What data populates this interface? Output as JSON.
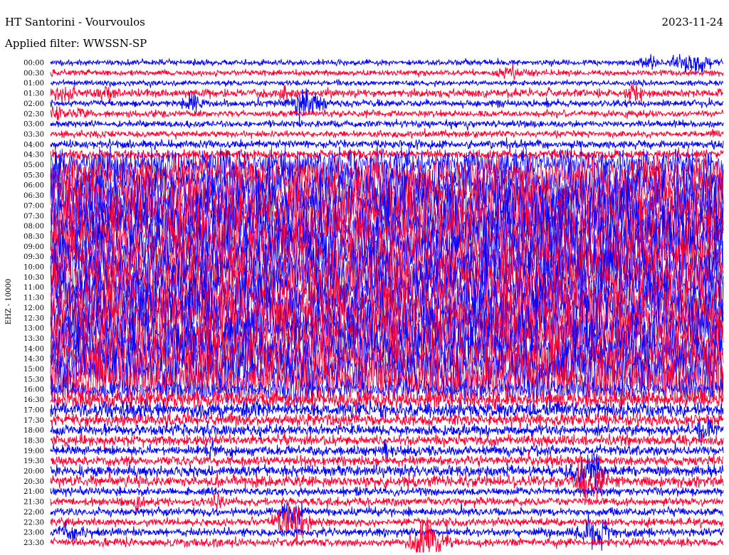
{
  "header": {
    "station": "HT Santorini - Vourvoulos",
    "date": "2023-11-24",
    "filter": "Applied filter: WWSSN-SP"
  },
  "colors": {
    "even_trace": "#0000ff",
    "odd_trace": "#ff0033",
    "background": "#ffffff",
    "text": "#000000"
  },
  "chart_data": {
    "type": "helicorder",
    "ylabel": "EHZ - 10000",
    "tick_labels": [
      "00:00",
      "00:30",
      "01:00",
      "01:30",
      "02:00",
      "02:30",
      "03:00",
      "03:30",
      "04:00",
      "04:30",
      "05:00",
      "05:30",
      "06:00",
      "06:30",
      "07:00",
      "07:30",
      "08:00",
      "08:30",
      "09:00",
      "09:30",
      "10:00",
      "10:30",
      "11:00",
      "11:30",
      "12:00",
      "12:30",
      "13:00",
      "13:30",
      "14:00",
      "14:30",
      "15:00",
      "15:30",
      "16:00",
      "16:30",
      "17:00",
      "17:30",
      "18:00",
      "18:30",
      "19:00",
      "19:30",
      "20:00",
      "20:30",
      "21:00",
      "21:30",
      "22:00",
      "22:30",
      "23:00",
      "23:30"
    ],
    "trace_colors_alternate": [
      "blue",
      "red"
    ],
    "activity_level": [
      0.25,
      0.25,
      0.2,
      0.4,
      0.3,
      0.3,
      0.3,
      0.3,
      0.4,
      0.5,
      1.8,
      2.2,
      3.0,
      3.2,
      3.2,
      3.2,
      3.2,
      3.0,
      3.0,
      3.0,
      3.0,
      3.0,
      3.0,
      3.0,
      3.0,
      3.0,
      3.0,
      3.0,
      3.0,
      3.0,
      3.0,
      2.8,
      1.2,
      1.0,
      0.9,
      0.7,
      0.6,
      0.6,
      0.5,
      0.5,
      0.6,
      0.6,
      0.4,
      0.4,
      0.4,
      0.4,
      0.4,
      0.4
    ],
    "events": [
      {
        "row": 0,
        "x": 0.95,
        "amp": 1.2,
        "w": 0.025
      },
      {
        "row": 0,
        "x": 0.89,
        "amp": 0.6,
        "w": 0.01
      },
      {
        "row": 1,
        "x": 0.69,
        "amp": 0.6,
        "w": 0.02
      },
      {
        "row": 3,
        "x": 0.02,
        "amp": 0.8,
        "w": 0.015
      },
      {
        "row": 3,
        "x": 0.08,
        "amp": 0.8,
        "w": 0.015
      },
      {
        "row": 3,
        "x": 0.35,
        "amp": 0.6,
        "w": 0.01
      },
      {
        "row": 3,
        "x": 0.87,
        "amp": 0.7,
        "w": 0.012
      },
      {
        "row": 4,
        "x": 0.38,
        "amp": 2.0,
        "w": 0.02
      },
      {
        "row": 4,
        "x": 0.21,
        "amp": 0.7,
        "w": 0.015
      },
      {
        "row": 5,
        "x": 0.01,
        "amp": 0.6,
        "w": 0.008
      },
      {
        "row": 5,
        "x": 0.04,
        "amp": 0.7,
        "w": 0.012
      },
      {
        "row": 18,
        "x": 0.78,
        "amp": 2.5,
        "w": 0.12
      },
      {
        "row": 32,
        "x": 0.22,
        "amp": 0.8,
        "w": 0.015
      },
      {
        "row": 32,
        "x": 0.36,
        "amp": 0.8,
        "w": 0.015
      },
      {
        "row": 32,
        "x": 0.72,
        "amp": 0.8,
        "w": 0.015
      },
      {
        "row": 36,
        "x": 0.97,
        "amp": 0.9,
        "w": 0.012
      },
      {
        "row": 38,
        "x": 0.24,
        "amp": 0.8,
        "w": 0.01
      },
      {
        "row": 38,
        "x": 0.5,
        "amp": 0.8,
        "w": 0.01
      },
      {
        "row": 40,
        "x": 0.8,
        "amp": 2.0,
        "w": 0.02
      },
      {
        "row": 41,
        "x": 0.8,
        "amp": 2.0,
        "w": 0.02
      },
      {
        "row": 43,
        "x": 0.13,
        "amp": 0.9,
        "w": 0.012
      },
      {
        "row": 43,
        "x": 0.25,
        "amp": 0.8,
        "w": 0.01
      },
      {
        "row": 44,
        "x": 0.36,
        "amp": 1.5,
        "w": 0.012
      },
      {
        "row": 45,
        "x": 0.36,
        "amp": 2.2,
        "w": 0.02
      },
      {
        "row": 46,
        "x": 0.81,
        "amp": 1.8,
        "w": 0.018
      },
      {
        "row": 46,
        "x": 0.03,
        "amp": 0.8,
        "w": 0.015
      },
      {
        "row": 47,
        "x": 0.56,
        "amp": 2.4,
        "w": 0.02
      }
    ]
  }
}
